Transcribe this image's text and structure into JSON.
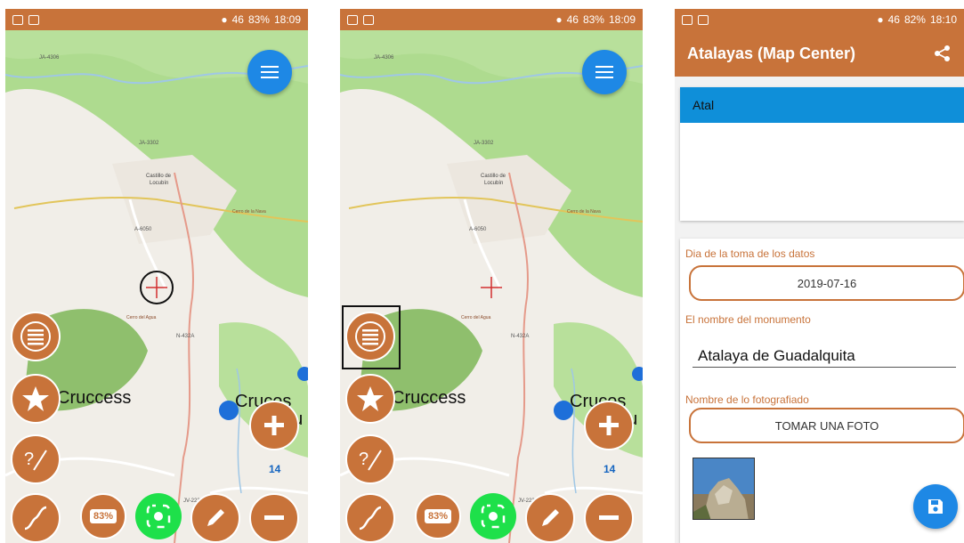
{
  "status_left": {
    "time": "18:09",
    "battery": "83%"
  },
  "status_right": {
    "time": "18:10",
    "battery": "82%"
  },
  "signal": "46",
  "map": {
    "label_overlap": "Cruccess",
    "label_cruces": "Cruces",
    "label_cru": "Cru",
    "number": "14",
    "battery_badge": "83%",
    "road_labels": [
      "JA-4306",
      "JA-3302",
      "A-6050",
      "N-432A",
      "JV-2230"
    ],
    "place_labels": [
      "Castillo de Locubín",
      "Cerro de la Nava",
      "Cerro del Agua"
    ]
  },
  "form": {
    "title": "Atalayas (Map Center)",
    "selected_item": "Atal",
    "date_label": "Dia de la toma de los datos",
    "date_value": "2019-07-16",
    "name_label": "El nombre del monumento",
    "name_value": "Atalaya de Guadalquita",
    "photo_label": "Nombre de lo fotografiado",
    "photo_button": "TOMAR UNA FOTO"
  },
  "colors": {
    "accent": "#c8733a",
    "primary_blue": "#1e88e5",
    "gps_green": "#1ee04a",
    "map_green": "#aedb8f"
  }
}
